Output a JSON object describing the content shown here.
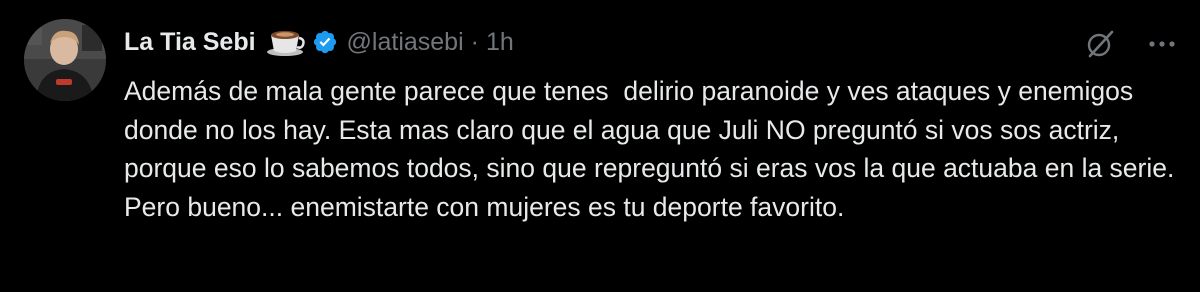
{
  "author": {
    "display_name": "La Tia Sebi",
    "name_emoji": "coffee-cup-emoji",
    "verified_icon": "verified-badge-icon",
    "handle": "@latiasebi",
    "separator": "·",
    "timestamp": "1h"
  },
  "actions": {
    "grok_icon": "grok-icon",
    "more_icon": "more-options-icon"
  },
  "tweet": {
    "text": "Además de mala gente parece que tenes  delirio paranoide y ves ataques y enemigos donde no los hay. Esta mas claro que el agua que Juli NO preguntó si vos sos actriz, porque eso lo sabemos todos, sino que repreguntó si eras vos la que actuaba en la serie.  Pero bueno... enemistarte con mujeres es tu deporte favorito."
  },
  "colors": {
    "background": "#000000",
    "primary_text": "#e7e9ea",
    "secondary_text": "#71767b",
    "verified_blue": "#1d9bf0"
  }
}
